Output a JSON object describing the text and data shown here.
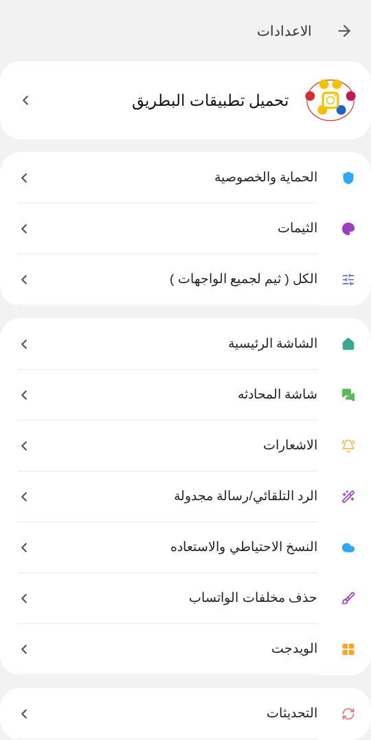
{
  "header": {
    "title": "الاعدادات"
  },
  "featured": {
    "label": "تحميل تطبيقات البطريق"
  },
  "groups": [
    {
      "items": [
        {
          "label": "الحماية والخصوصية"
        },
        {
          "label": "الثيمات"
        },
        {
          "label": "الكل ( ثيم لجميع الواجهات )"
        }
      ]
    },
    {
      "items": [
        {
          "label": "الشاشة الرئيسية"
        },
        {
          "label": "شاشة المحادثه"
        },
        {
          "label": "الاشعارات"
        },
        {
          "label": "الرد التلقائي/رسالة مجدولة"
        },
        {
          "label": "النسخ الاحتياطي والاستعاده"
        },
        {
          "label": "حذف مخلفات الواتساب"
        },
        {
          "label": "الويدجت"
        }
      ]
    },
    {
      "items": [
        {
          "label": "التحديثات"
        }
      ]
    }
  ]
}
